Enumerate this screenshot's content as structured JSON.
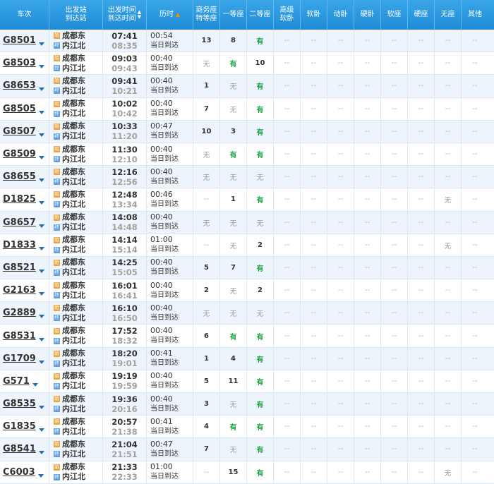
{
  "headers": {
    "train": "车次",
    "stations": "出发站\n到达站",
    "times": "出发时间\n到达时间",
    "duration": "历时",
    "business": "商务座\n特等座",
    "first": "一等座",
    "second": "二等座",
    "premium_sleeper": "高级\n软卧",
    "soft_sleeper": "软卧",
    "motion_sleeper": "动卧",
    "hard_sleeper": "硬卧",
    "soft_seat": "软座",
    "hard_seat": "硬座",
    "no_seat": "无座",
    "other": "其他"
  },
  "icons": {
    "start": "始",
    "end": "终",
    "dropdown": "chevron-down-icon",
    "sort": "sort-arrows-icon"
  },
  "colors": {
    "header_bg": "#2a98df",
    "available": "#21a34a",
    "none": "#9a9a9a",
    "row_alt": "#eef4fb"
  },
  "rows": [
    {
      "train": "G8501",
      "from": "成都东",
      "to": "内江北",
      "dep": "07:41",
      "arr": "08:35",
      "dur": "00:54",
      "day": "当日到达",
      "business": "13",
      "first": "8",
      "second": "有",
      "premium_sleeper": "--",
      "soft_sleeper": "--",
      "motion_sleeper": "--",
      "hard_sleeper": "--",
      "soft_seat": "--",
      "hard_seat": "--",
      "no_seat": "--",
      "other": "--"
    },
    {
      "train": "G8503",
      "from": "成都东",
      "to": "内江北",
      "dep": "09:03",
      "arr": "09:43",
      "dur": "00:40",
      "day": "当日到达",
      "business": "无",
      "first": "有",
      "second": "10",
      "premium_sleeper": "--",
      "soft_sleeper": "--",
      "motion_sleeper": "--",
      "hard_sleeper": "--",
      "soft_seat": "--",
      "hard_seat": "--",
      "no_seat": "--",
      "other": "--"
    },
    {
      "train": "G8653",
      "from": "成都东",
      "to": "内江北",
      "dep": "09:41",
      "arr": "10:21",
      "dur": "00:40",
      "day": "当日到达",
      "business": "1",
      "first": "无",
      "second": "有",
      "premium_sleeper": "--",
      "soft_sleeper": "--",
      "motion_sleeper": "--",
      "hard_sleeper": "--",
      "soft_seat": "--",
      "hard_seat": "--",
      "no_seat": "--",
      "other": "--"
    },
    {
      "train": "G8505",
      "from": "成都东",
      "to": "内江北",
      "dep": "10:02",
      "arr": "10:42",
      "dur": "00:40",
      "day": "当日到达",
      "business": "7",
      "first": "无",
      "second": "有",
      "premium_sleeper": "--",
      "soft_sleeper": "--",
      "motion_sleeper": "--",
      "hard_sleeper": "--",
      "soft_seat": "--",
      "hard_seat": "--",
      "no_seat": "--",
      "other": "--"
    },
    {
      "train": "G8507",
      "from": "成都东",
      "to": "内江北",
      "dep": "10:33",
      "arr": "11:20",
      "dur": "00:47",
      "day": "当日到达",
      "business": "10",
      "first": "3",
      "second": "有",
      "premium_sleeper": "--",
      "soft_sleeper": "--",
      "motion_sleeper": "--",
      "hard_sleeper": "--",
      "soft_seat": "--",
      "hard_seat": "--",
      "no_seat": "--",
      "other": "--"
    },
    {
      "train": "G8509",
      "from": "成都东",
      "to": "内江北",
      "dep": "11:30",
      "arr": "12:10",
      "dur": "00:40",
      "day": "当日到达",
      "business": "无",
      "first": "有",
      "second": "有",
      "premium_sleeper": "--",
      "soft_sleeper": "--",
      "motion_sleeper": "--",
      "hard_sleeper": "--",
      "soft_seat": "--",
      "hard_seat": "--",
      "no_seat": "--",
      "other": "--"
    },
    {
      "train": "G8655",
      "from": "成都东",
      "to": "内江北",
      "dep": "12:16",
      "arr": "12:56",
      "dur": "00:40",
      "day": "当日到达",
      "business": "无",
      "first": "无",
      "second": "无",
      "premium_sleeper": "--",
      "soft_sleeper": "--",
      "motion_sleeper": "--",
      "hard_sleeper": "--",
      "soft_seat": "--",
      "hard_seat": "--",
      "no_seat": "--",
      "other": "--"
    },
    {
      "train": "D1825",
      "from": "成都东",
      "to": "内江北",
      "dep": "12:48",
      "arr": "13:34",
      "dur": "00:46",
      "day": "当日到达",
      "business": "--",
      "first": "1",
      "second": "有",
      "premium_sleeper": "--",
      "soft_sleeper": "--",
      "motion_sleeper": "--",
      "hard_sleeper": "--",
      "soft_seat": "--",
      "hard_seat": "--",
      "no_seat": "无",
      "other": "--"
    },
    {
      "train": "G8657",
      "from": "成都东",
      "to": "内江北",
      "dep": "14:08",
      "arr": "14:48",
      "dur": "00:40",
      "day": "当日到达",
      "business": "无",
      "first": "无",
      "second": "无",
      "premium_sleeper": "--",
      "soft_sleeper": "--",
      "motion_sleeper": "--",
      "hard_sleeper": "--",
      "soft_seat": "--",
      "hard_seat": "--",
      "no_seat": "--",
      "other": "--"
    },
    {
      "train": "D1833",
      "from": "成都东",
      "to": "内江北",
      "dep": "14:14",
      "arr": "15:14",
      "dur": "01:00",
      "day": "当日到达",
      "business": "--",
      "first": "无",
      "second": "2",
      "premium_sleeper": "--",
      "soft_sleeper": "--",
      "motion_sleeper": "--",
      "hard_sleeper": "--",
      "soft_seat": "--",
      "hard_seat": "--",
      "no_seat": "无",
      "other": "--"
    },
    {
      "train": "G8521",
      "from": "成都东",
      "to": "内江北",
      "dep": "14:25",
      "arr": "15:05",
      "dur": "00:40",
      "day": "当日到达",
      "business": "5",
      "first": "7",
      "second": "有",
      "premium_sleeper": "--",
      "soft_sleeper": "--",
      "motion_sleeper": "--",
      "hard_sleeper": "--",
      "soft_seat": "--",
      "hard_seat": "--",
      "no_seat": "--",
      "other": "--"
    },
    {
      "train": "G2163",
      "from": "成都东",
      "to": "内江北",
      "dep": "16:01",
      "arr": "16:41",
      "dur": "00:40",
      "day": "当日到达",
      "business": "2",
      "first": "无",
      "second": "2",
      "premium_sleeper": "--",
      "soft_sleeper": "--",
      "motion_sleeper": "--",
      "hard_sleeper": "--",
      "soft_seat": "--",
      "hard_seat": "--",
      "no_seat": "--",
      "other": "--"
    },
    {
      "train": "G2889",
      "from": "成都东",
      "to": "内江北",
      "dep": "16:10",
      "arr": "16:50",
      "dur": "00:40",
      "day": "当日到达",
      "business": "无",
      "first": "无",
      "second": "无",
      "premium_sleeper": "--",
      "soft_sleeper": "--",
      "motion_sleeper": "--",
      "hard_sleeper": "--",
      "soft_seat": "--",
      "hard_seat": "--",
      "no_seat": "--",
      "other": "--"
    },
    {
      "train": "G8531",
      "from": "成都东",
      "to": "内江北",
      "dep": "17:52",
      "arr": "18:32",
      "dur": "00:40",
      "day": "当日到达",
      "business": "6",
      "first": "有",
      "second": "有",
      "premium_sleeper": "--",
      "soft_sleeper": "--",
      "motion_sleeper": "--",
      "hard_sleeper": "--",
      "soft_seat": "--",
      "hard_seat": "--",
      "no_seat": "--",
      "other": "--"
    },
    {
      "train": "G1709",
      "from": "成都东",
      "to": "内江北",
      "dep": "18:20",
      "arr": "19:01",
      "dur": "00:41",
      "day": "当日到达",
      "business": "1",
      "first": "4",
      "second": "有",
      "premium_sleeper": "--",
      "soft_sleeper": "--",
      "motion_sleeper": "--",
      "hard_sleeper": "--",
      "soft_seat": "--",
      "hard_seat": "--",
      "no_seat": "--",
      "other": "--"
    },
    {
      "train": "G571",
      "from": "成都东",
      "to": "内江北",
      "dep": "19:19",
      "arr": "19:59",
      "dur": "00:40",
      "day": "当日到达",
      "business": "5",
      "first": "11",
      "second": "有",
      "premium_sleeper": "--",
      "soft_sleeper": "--",
      "motion_sleeper": "--",
      "hard_sleeper": "--",
      "soft_seat": "--",
      "hard_seat": "--",
      "no_seat": "--",
      "other": "--"
    },
    {
      "train": "G8535",
      "from": "成都东",
      "to": "内江北",
      "dep": "19:36",
      "arr": "20:16",
      "dur": "00:40",
      "day": "当日到达",
      "business": "3",
      "first": "无",
      "second": "有",
      "premium_sleeper": "--",
      "soft_sleeper": "--",
      "motion_sleeper": "--",
      "hard_sleeper": "--",
      "soft_seat": "--",
      "hard_seat": "--",
      "no_seat": "--",
      "other": "--"
    },
    {
      "train": "G1835",
      "from": "成都东",
      "to": "内江北",
      "dep": "20:57",
      "arr": "21:38",
      "dur": "00:41",
      "day": "当日到达",
      "business": "4",
      "first": "有",
      "second": "有",
      "premium_sleeper": "--",
      "soft_sleeper": "--",
      "motion_sleeper": "--",
      "hard_sleeper": "--",
      "soft_seat": "--",
      "hard_seat": "--",
      "no_seat": "--",
      "other": "--"
    },
    {
      "train": "G8541",
      "from": "成都东",
      "to": "内江北",
      "dep": "21:04",
      "arr": "21:51",
      "dur": "00:47",
      "day": "当日到达",
      "business": "7",
      "first": "无",
      "second": "有",
      "premium_sleeper": "--",
      "soft_sleeper": "--",
      "motion_sleeper": "--",
      "hard_sleeper": "--",
      "soft_seat": "--",
      "hard_seat": "--",
      "no_seat": "--",
      "other": "--"
    },
    {
      "train": "C6003",
      "from": "成都东",
      "to": "内江北",
      "dep": "21:33",
      "arr": "22:33",
      "dur": "01:00",
      "day": "当日到达",
      "business": "--",
      "first": "15",
      "second": "有",
      "premium_sleeper": "--",
      "soft_sleeper": "--",
      "motion_sleeper": "--",
      "hard_sleeper": "--",
      "soft_seat": "--",
      "hard_seat": "--",
      "no_seat": "无",
      "other": "--"
    }
  ]
}
